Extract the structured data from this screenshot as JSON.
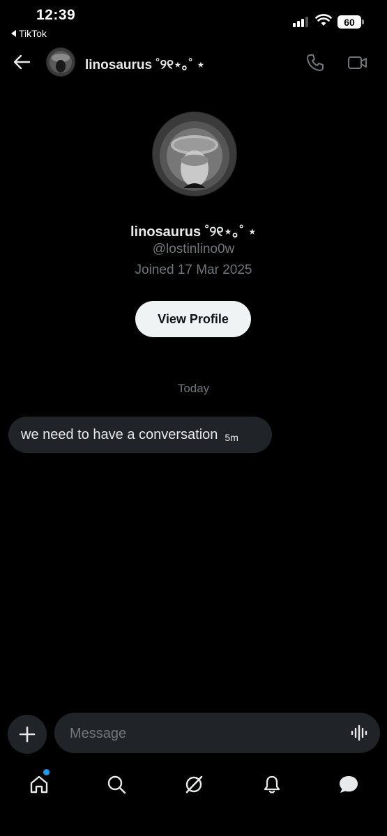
{
  "status_bar": {
    "time": "12:39",
    "back_app": "TikTok",
    "battery": "60"
  },
  "header": {
    "name": "linosaurus ˚୨୧⋆｡˚ ⋆",
    "icons": [
      "back-arrow-icon",
      "avatar",
      "phone-icon",
      "video-icon"
    ]
  },
  "profile": {
    "name": "linosaurus ˚୨୧⋆｡˚ ⋆",
    "handle": "@lostinlino0w",
    "joined": "Joined 17 Mar 2025",
    "button": "View Profile"
  },
  "chat": {
    "date_separator": "Today",
    "messages": [
      {
        "text": "we need to have a conversation",
        "time": "5m"
      }
    ]
  },
  "composer": {
    "placeholder": "Message"
  },
  "nav": {
    "items": [
      "home-icon",
      "search-icon",
      "grok-icon",
      "notifications-icon",
      "messages-icon"
    ],
    "accent": "#1d9bf0"
  }
}
